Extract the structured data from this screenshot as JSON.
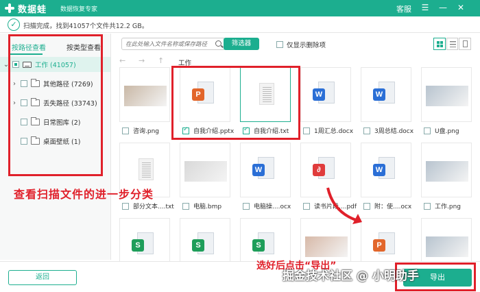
{
  "titlebar": {
    "app_name": "数据蛙",
    "subtitle": "数据恢复专家",
    "service": "客服",
    "menu_icon": "menu-icon",
    "min_icon": "minimize-icon",
    "close_icon": "close-icon"
  },
  "status": {
    "text": "扫描完成，找到41057个文件共12.2 GB。"
  },
  "sidebar": {
    "tabs": [
      {
        "label": "按路径查看",
        "active": true
      },
      {
        "label": "按类型查看",
        "active": false
      }
    ],
    "root": {
      "label": "工作 (41057)"
    },
    "items": [
      {
        "label": "其他路径 (7269)",
        "expandable": true
      },
      {
        "label": "丢失路径 (33743)",
        "expandable": true
      },
      {
        "label": "日常图库 (2)",
        "expandable": false
      },
      {
        "label": "桌面壁纸 (1)",
        "expandable": false
      }
    ]
  },
  "toolbar": {
    "search_placeholder": "在此处输入文件名称或保存路径",
    "filter_label": "筛选器",
    "only_deleted_label": "仅显示删除项"
  },
  "nav": {
    "path": "工作"
  },
  "files": [
    {
      "name": "咨询.png",
      "type": "photo",
      "checked": false,
      "selected": false
    },
    {
      "name": "自我介绍.pptx",
      "type": "pptx",
      "checked": true,
      "selected": false
    },
    {
      "name": "自我介绍.txt",
      "type": "txt",
      "checked": true,
      "selected": true
    },
    {
      "name": "1周汇总.docx",
      "type": "docx",
      "checked": false,
      "selected": false
    },
    {
      "name": "3周总结.docx",
      "type": "docx",
      "checked": false,
      "selected": false
    },
    {
      "name": "U盘.png",
      "type": "photo",
      "checked": false,
      "selected": false
    },
    {
      "name": "部分文本....txt",
      "type": "txt",
      "checked": false,
      "selected": false
    },
    {
      "name": "电脑.bmp",
      "type": "photo",
      "checked": false,
      "selected": false
    },
    {
      "name": "电脑操....ocx",
      "type": "docx",
      "checked": false,
      "selected": false
    },
    {
      "name": "读书片段....pdf",
      "type": "pdf",
      "checked": false,
      "selected": false
    },
    {
      "name": "附：使....ocx",
      "type": "docx",
      "checked": false,
      "selected": false
    },
    {
      "name": "工作.png",
      "type": "photo",
      "checked": false,
      "selected": false
    },
    {
      "name": "",
      "type": "xlsx",
      "checked": false,
      "selected": false
    },
    {
      "name": "",
      "type": "xlsx",
      "checked": false,
      "selected": false
    },
    {
      "name": "",
      "type": "xlsx",
      "checked": false,
      "selected": false
    },
    {
      "name": "",
      "type": "photo",
      "checked": false,
      "selected": false
    },
    {
      "name": "",
      "type": "pptx",
      "checked": false,
      "selected": false
    },
    {
      "name": "",
      "type": "photo",
      "checked": false,
      "selected": false
    }
  ],
  "bottom": {
    "back_label": "返回",
    "export_label": "导出"
  },
  "annotations": {
    "left_note": "查看扫描文件的进一步分类",
    "right_note": "选好后点击“导出”",
    "watermark": "掘金技术社区 @ 小明助手"
  },
  "colors": {
    "accent": "#1cae8f",
    "annotation_red": "#e0202a",
    "word_blue": "#2b6fd6",
    "ppt_orange": "#e2662b",
    "excel_green": "#1e9e5a",
    "pdf_red": "#e03c3c"
  }
}
